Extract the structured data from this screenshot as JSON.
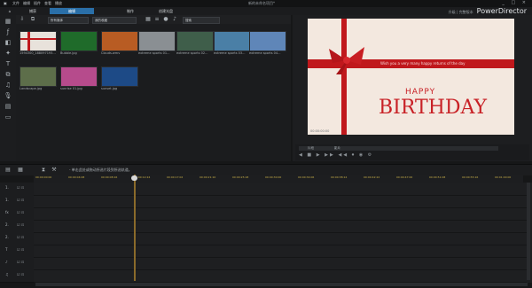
{
  "titlebar": {
    "menu": [
      "文件",
      "编辑",
      "插件",
      "查看",
      "播放",
      "帮助"
    ],
    "title": "新的未命名项目*",
    "window_controls": "_ □ ×"
  },
  "modebar": {
    "capture": "捕获",
    "edit": "编辑",
    "produce": "制作",
    "disc": "创建光盘",
    "brand": "PowerDirector",
    "brand_note": "升级 | 完整版本"
  },
  "library": {
    "filter": "所有媒体",
    "sort": "我的收藏",
    "search_placeholder": "搜索",
    "items": [
      {
        "name": "1594300_188097193...",
        "color": "#c9473a"
      },
      {
        "name": "Bubble.jpg",
        "color": "#1f6b2a"
      },
      {
        "name": "Clouds.wmv",
        "color": "#b85c23"
      },
      {
        "name": "extreme sports 01...",
        "color": "#8a8f93"
      },
      {
        "name": "extreme sports 02...",
        "color": "#3f5e4a"
      },
      {
        "name": "extreme sports 03...",
        "color": "#4a7fa6"
      },
      {
        "name": "extreme sports 04...",
        "color": "#5f86b8"
      },
      {
        "name": "Landscape.jpg",
        "color": "#5d6e4a"
      },
      {
        "name": "sunrise 01.jpg",
        "color": "#b64b8c"
      },
      {
        "name": "sunset.jpg",
        "color": "#1d4a86"
      }
    ]
  },
  "preview": {
    "ribbon_text": "Wish you a very many happy returns of the day",
    "happy": "HAPPY",
    "birthday": "BIRTHDAY",
    "timecode": "00:00:00:00",
    "tab1": "片段",
    "tab2": "影片",
    "transport": "◀ ■ ▶ ▶▶ ◀◀ ⏺ ◉ ⚙"
  },
  "timeline": {
    "hint": "- 单击此处或拖动所选片段到所选轨道。",
    "ticks": [
      "00:00:00:00",
      "00:00:04:08",
      "00:00:08:16",
      "00:00:12:24",
      "00:00:17:02",
      "00:00:21:10",
      "00:00:25:18",
      "00:00:30:00",
      "00:00:34:06",
      "00:00:38:14",
      "00:00:42:22",
      "00:00:47:00",
      "00:00:51:08",
      "00:00:55:16",
      "00:01:00:00"
    ],
    "tracks": [
      "1.",
      "1.",
      "fx",
      "2.",
      "2.",
      "T",
      "♪",
      "♫"
    ]
  },
  "colors": {
    "accent": "#2a6fa8",
    "ribbon": "#c0181c",
    "ruler_text": "#c9b048"
  }
}
